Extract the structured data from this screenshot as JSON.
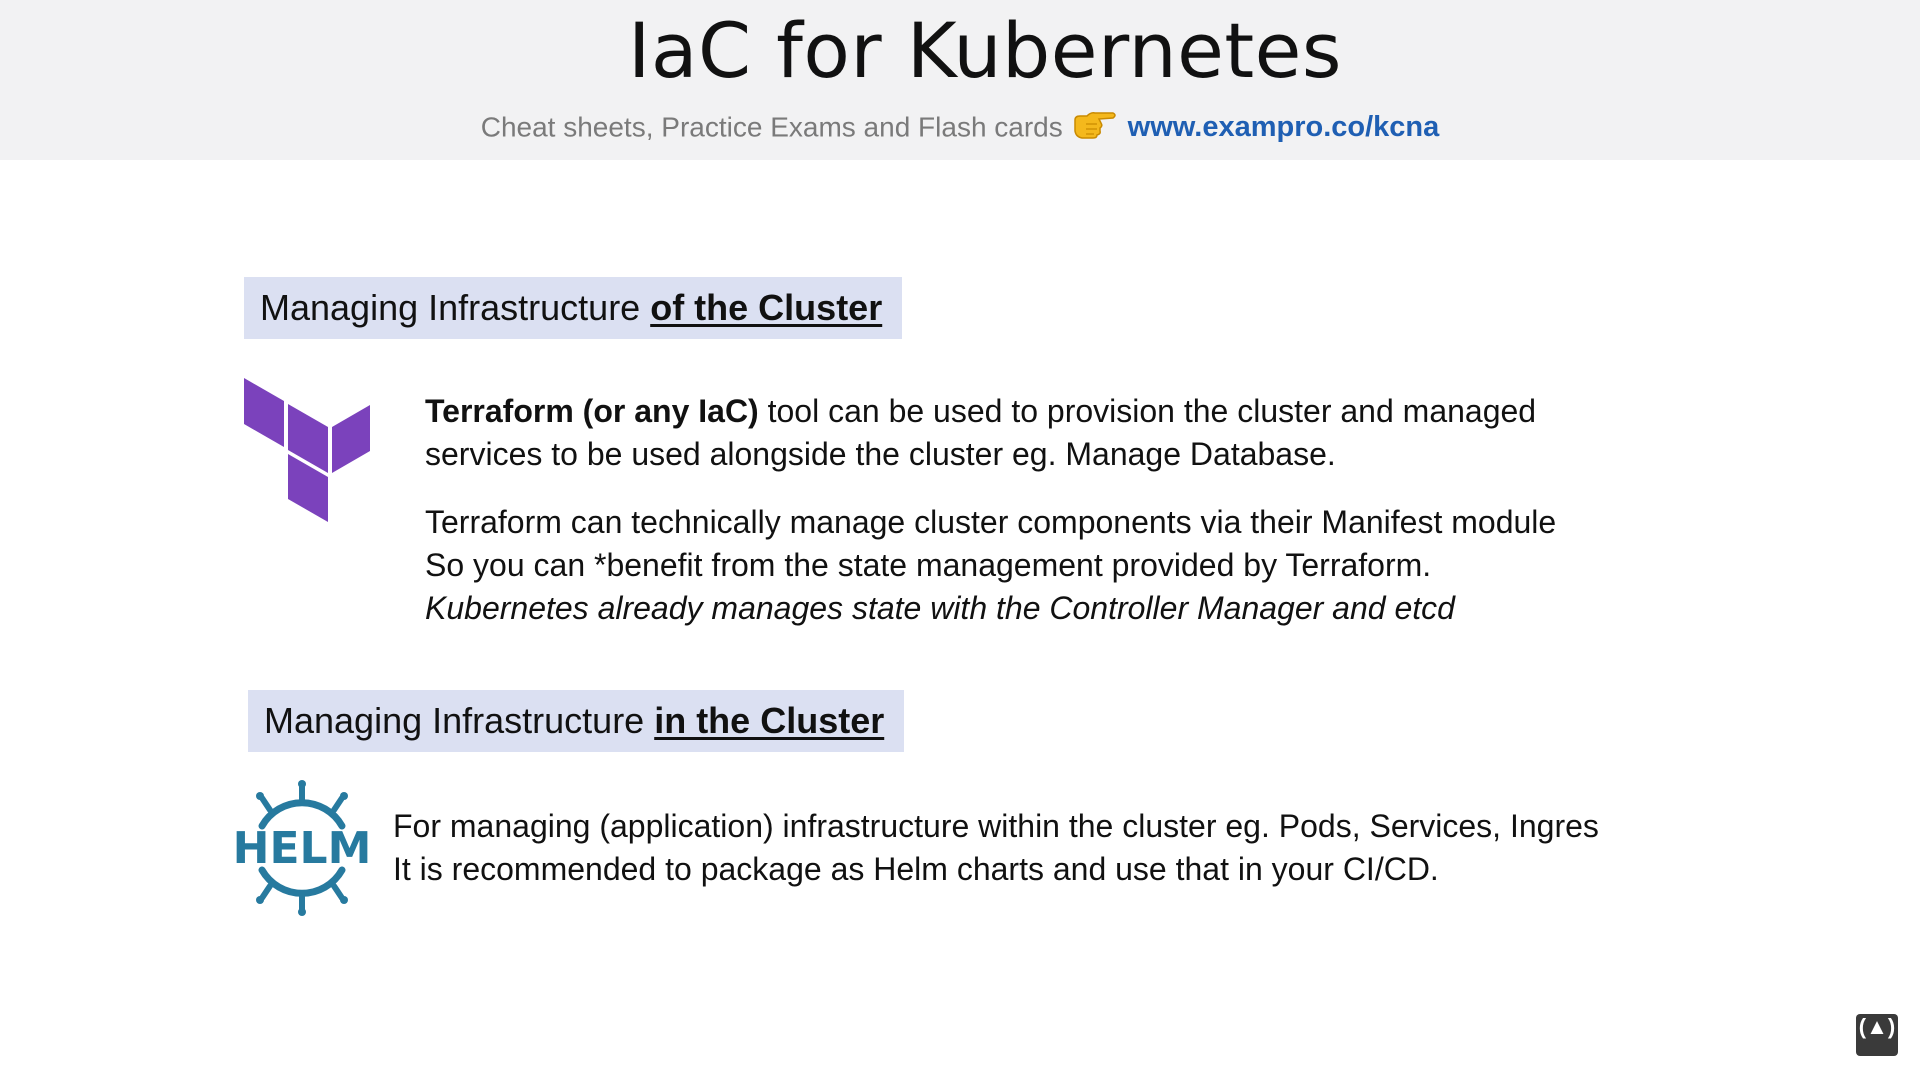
{
  "header": {
    "title": "IaC for Kubernetes",
    "subtitle": "Cheat sheets, Practice Exams and Flash cards",
    "hand_icon": "pointing-hand-icon",
    "url": "www.exampro.co/kcna"
  },
  "section1": {
    "heading_plain": "Managing Infrastructure ",
    "heading_emphasis": "of the Cluster",
    "logo_icon": "terraform-logo",
    "logo_color": "#7b42bc",
    "p1_bold": "Terraform (or any IaC)",
    "p1_line1_rest": " tool can be used to provision the cluster and managed",
    "p1_line2": "services to be used alongside the cluster eg. Manage Database.",
    "p2_line1": "Terraform can technically manage cluster components via their Manifest module",
    "p2_line2": "So you can *benefit from the state management provided by Terraform.",
    "p2_line3_italic": "Kubernetes already manages state with the Controller Manager and etcd"
  },
  "section2": {
    "heading_plain": "Managing Infrastructure ",
    "heading_emphasis": "in the Cluster",
    "logo_icon": "helm-logo",
    "logo_text": "HELM",
    "logo_color": "#277a9f",
    "p_line1": "For managing (application) infrastructure within the cluster eg. Pods, Services, Ingres",
    "p_line2": "It is recommended to package as Helm charts and use that in your CI/CD."
  },
  "colors": {
    "header_bg": "#f2f2f3",
    "section_header_bg": "#dbe0f2",
    "url_color": "#1f5fb3"
  }
}
